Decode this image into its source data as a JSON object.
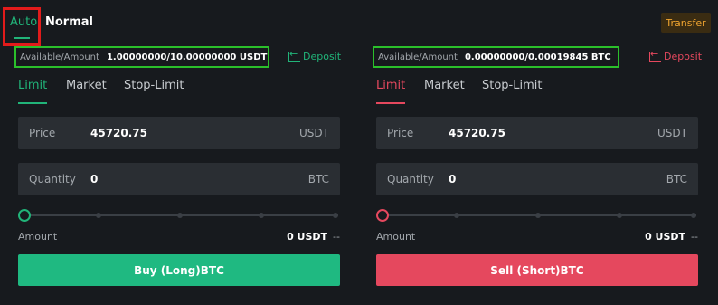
{
  "mode_tabs": {
    "auto": "Auto",
    "normal": "Normal"
  },
  "transfer_label": "Transfer",
  "buy": {
    "available_label": "Available/Amount",
    "available_value": "1.00000000/10.00000000 USDT",
    "deposit_label": "Deposit",
    "tabs": [
      "Limit",
      "Market",
      "Stop-Limit"
    ],
    "price_label": "Price",
    "price_value": "45720.75",
    "price_unit": "USDT",
    "quantity_label": "Quantity",
    "quantity_value": "0",
    "quantity_unit": "BTC",
    "slider_percent": 0,
    "amount_label": "Amount",
    "amount_value": "0 USDT",
    "amount_dash": "--",
    "button_label": "Buy (Long)BTC"
  },
  "sell": {
    "available_label": "Available/Amount",
    "available_value": "0.00000000/0.00019845 BTC",
    "deposit_label": "Deposit",
    "tabs": [
      "Limit",
      "Market",
      "Stop-Limit"
    ],
    "price_label": "Price",
    "price_value": "45720.75",
    "price_unit": "USDT",
    "quantity_label": "Quantity",
    "quantity_value": "0",
    "quantity_unit": "BTC",
    "slider_percent": 0,
    "amount_label": "Amount",
    "amount_value": "0 USDT",
    "amount_dash": "--",
    "button_label": "Sell (Short)BTC"
  },
  "colors": {
    "buy_accent": "#21b479",
    "sell_accent": "#e5485e",
    "transfer": "#f0a530",
    "background": "#171a1e",
    "input_bg": "#2a2e33"
  }
}
